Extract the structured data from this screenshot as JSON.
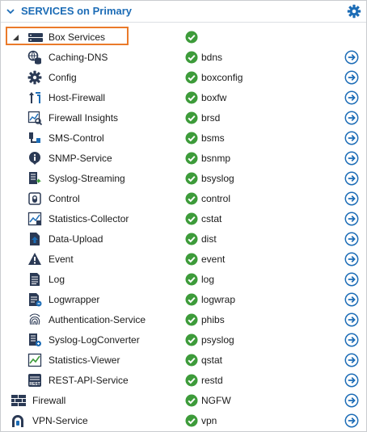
{
  "header": {
    "title": "SERVICES on Primary"
  },
  "box_services": {
    "label": "Box Services"
  },
  "services": [
    {
      "name": "Caching-DNS",
      "proc": "bdns",
      "icon": "dns-icon",
      "status": "running"
    },
    {
      "name": "Config",
      "proc": "boxconfig",
      "icon": "gear-icon",
      "status": "running"
    },
    {
      "name": "Host-Firewall",
      "proc": "boxfw",
      "icon": "host-firewall-icon",
      "status": "running"
    },
    {
      "name": "Firewall Insights",
      "proc": "brsd",
      "icon": "insights-icon",
      "status": "running"
    },
    {
      "name": "SMS-Control",
      "proc": "bsms",
      "icon": "sms-icon",
      "status": "running"
    },
    {
      "name": "SNMP-Service",
      "proc": "bsnmp",
      "icon": "info-icon",
      "status": "running"
    },
    {
      "name": "Syslog-Streaming",
      "proc": "bsyslog",
      "icon": "syslog-icon",
      "status": "running"
    },
    {
      "name": "Control",
      "proc": "control",
      "icon": "control-icon",
      "status": "running"
    },
    {
      "name": "Statistics-Collector",
      "proc": "cstat",
      "icon": "statistics-collector-icon",
      "status": "running"
    },
    {
      "name": "Data-Upload",
      "proc": "dist",
      "icon": "upload-icon",
      "status": "running"
    },
    {
      "name": "Event",
      "proc": "event",
      "icon": "warning-icon",
      "status": "running"
    },
    {
      "name": "Log",
      "proc": "log",
      "icon": "log-icon",
      "status": "running"
    },
    {
      "name": "Logwrapper",
      "proc": "logwrap",
      "icon": "logwrapper-icon",
      "status": "running"
    },
    {
      "name": "Authentication-Service",
      "proc": "phibs",
      "icon": "fingerprint-icon",
      "status": "running"
    },
    {
      "name": "Syslog-LogConverter",
      "proc": "psyslog",
      "icon": "logconverter-icon",
      "status": "running"
    },
    {
      "name": "Statistics-Viewer",
      "proc": "qstat",
      "icon": "chart-icon",
      "status": "running"
    },
    {
      "name": "REST-API-Service",
      "proc": "restd",
      "icon": "rest-icon",
      "status": "running"
    }
  ],
  "top_services": [
    {
      "name": "Firewall",
      "proc": "NGFW",
      "icon": "firewall-wall-icon",
      "status": "running"
    },
    {
      "name": "VPN-Service",
      "proc": "vpn",
      "icon": "vpn-icon",
      "status": "running"
    }
  ],
  "colors": {
    "accent": "#1c6cb6",
    "ok": "#3d9b3a",
    "highlight": "#ea7a2a",
    "icon": "#2b3a55"
  }
}
